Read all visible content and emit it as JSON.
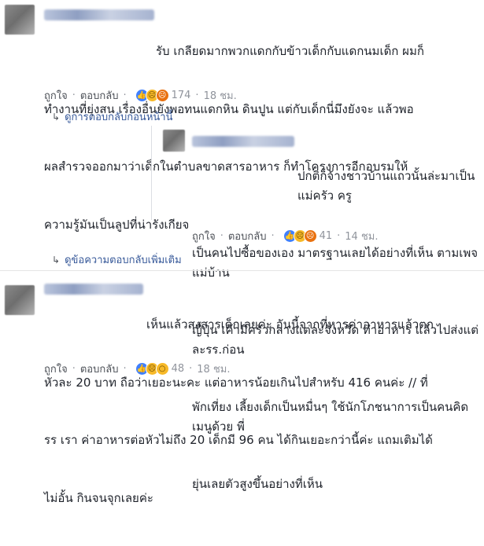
{
  "comments": [
    {
      "name": "■■■■■■■■■■",
      "lines": [
        "รับ เกลียดมากพวกแดกกับข้าวเด็กกับแดกนมเด็ก ผมก็",
        "ทำงานที่ยุ่งสน เรื่องอื่นยังพอทนแดกหิน ดินปูน แต่กับเด็กนี่มึงยังจะ แล้วพอ",
        "ผลสำรวจออกมาว่าเด็กในตำบลขาดสารอาหาร ก็ทำโครงการอีกอบรมให้",
        "ความรู้มันเป็นลูปที่น่ารังเกียจ"
      ],
      "like": "ถูกใจ",
      "reply": "ตอบกลับ",
      "reactions": [
        "like",
        "sad",
        "angry"
      ],
      "count": "174",
      "time": "18 ชม."
    },
    {
      "name": "■■■■■■■■■■■■",
      "lines": [
        "ปกติก็จ้างชาวบ้านแถวนั้นล่ะมาเป็นแม่ครัว ครู",
        "เป็นคนไปซื้อของเอง มาตรฐานเลยได้อย่างที่เห็น ตามเพจแม่บ้าน",
        "ญี่ปุ่น เค้ามีครัวกลางแต่ละจังหวัด ทำอาหาร แล้วไปส่งแต่ละรร.ก่อน",
        "พักเที่ยง เลี้ยงเด็กเป็นหมื่นๆ ใช้นักโภชนาการเป็นคนคิดเมนูด้วย พี่",
        "ยุ่นเลยตัวสูงขึ้นอย่างที่เห็น"
      ],
      "like": "ถูกใจ",
      "reply": "ตอบกลับ",
      "reactions": [
        "like",
        "sad",
        "angry"
      ],
      "count": "41",
      "time": "14 ชม."
    },
    {
      "name": "■■■■■■■■■■■■",
      "lines": [
        "เห็นแล้วสงสารเด็กเลยค่ะ อันนี้จากที่หารค่าอาหารแล้วตก",
        "หัวละ 20 บาท ถือว่าเยอะนะคะ แต่อาหารน้อยเกินไปสำหรับ 416 คนค่ะ // ที่",
        "รร เรา ค่าอาหารต่อหัวไม่ถึง 20 เด็กมี 96 คน ได้กินเยอะกว่านี้ค่ะ แถมเติมได้",
        "ไม่อั้น กินจนจุกเลยค่ะ"
      ],
      "like": "ถูกใจ",
      "reply": "ตอบกลับ",
      "reactions": [
        "like",
        "sad",
        "wow"
      ],
      "count": "48",
      "time": "18 ชม."
    }
  ],
  "prev_replies": "ดูการตอบกลับก่อนหน้านี้",
  "more_replies": "ดูข้อความตอบกลับเพิ่มเติม",
  "icons": {
    "arrow": "reply-arrow-icon",
    "like": "like-reaction-icon",
    "sad": "sad-reaction-icon",
    "angry": "angry-reaction-icon",
    "wow": "wow-reaction-icon"
  },
  "colors": {
    "link": "#365899",
    "meta": "#90949c",
    "like": "#4080ff",
    "yellow": "#f7b928"
  }
}
